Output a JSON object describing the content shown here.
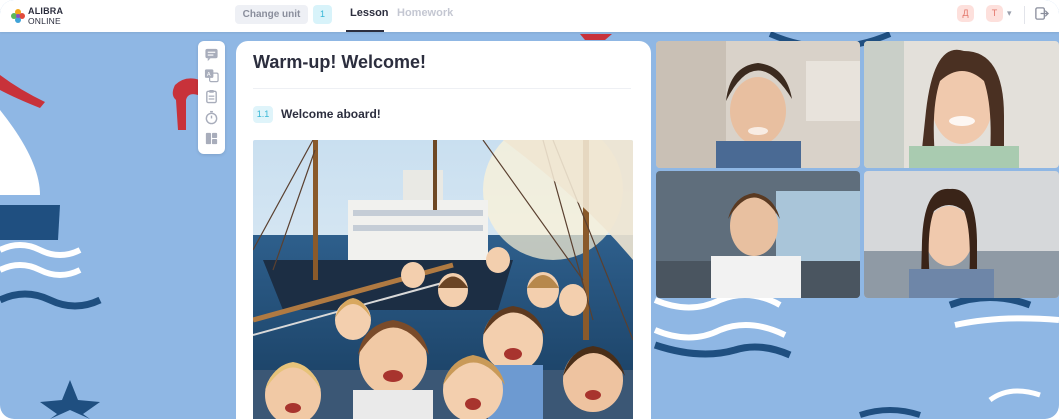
{
  "header": {
    "logo": {
      "line1": "ALIBRA",
      "line2": "ONLINE"
    },
    "change_unit_label": "Change unit",
    "unit_number": "1",
    "tabs": [
      {
        "label": "Lesson",
        "active": true
      },
      {
        "label": "Homework",
        "active": false
      }
    ],
    "user_avatars": [
      "Д",
      "Т"
    ]
  },
  "lesson": {
    "title": "Warm-up! Welcome!",
    "section": {
      "number": "1.1",
      "title": "Welcome aboard!"
    }
  },
  "sidebar_tools": [
    "chat-icon",
    "translate-icon",
    "clipboard-icon",
    "timer-icon",
    "layout-icon"
  ],
  "videos": [
    {
      "participant": "boy-student-1"
    },
    {
      "participant": "teacher"
    },
    {
      "participant": "boy-student-2"
    },
    {
      "participant": "girl-student"
    }
  ],
  "colors": {
    "background": "#8fb7e4",
    "accent": "#37b7d6",
    "text": "#2c2e3e",
    "deco_dark": "#1f4f80",
    "deco_red": "#c8323a"
  }
}
